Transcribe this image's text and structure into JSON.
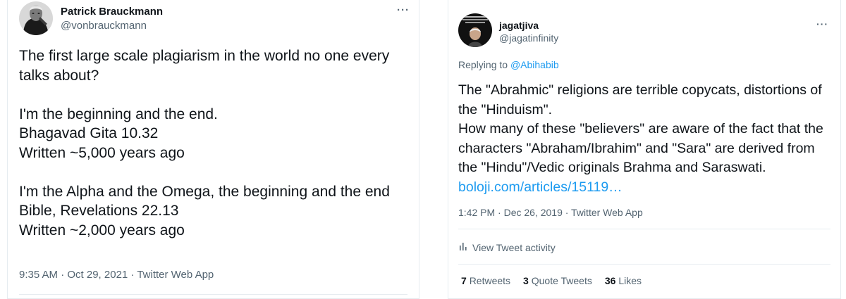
{
  "left_tweet": {
    "name": "Patrick Brauckmann",
    "handle": "@vonbrauckmann",
    "text": "The first large scale plagiarism in the world no one every talks about?\n\nI'm the beginning and the end.\nBhagavad Gita 10.32\nWritten ~5,000 years ago\n\nI'm the Alpha and the Omega, the beginning and the end\nBible, Revelations 22.13\nWritten ~2,000 years ago",
    "meta": "9:35 AM · Oct 29, 2021 · Twitter Web App",
    "more_icon": "more-icon"
  },
  "right_tweet": {
    "name": "jagatjiva",
    "handle": "@jagatinfinity",
    "reply_prefix": "Replying to ",
    "reply_to": "@Abihabib",
    "text": "The \"Abrahmic\" religions are terrible copycats, distortions of the \"Hinduism\".\nHow many of these  \"believers\" are aware of the fact that the characters \"Abraham/Ibrahim\"  and \"Sara\" are derived from the \"Hindu\"/Vedic originals Brahma and Saraswati. ",
    "link": "boloji.com/articles/15119…",
    "meta": "1:42 PM · Dec 26, 2019 · Twitter Web App",
    "activity_label": "View Tweet activity",
    "stats": {
      "retweets_count": "7",
      "retweets_label": "Retweets",
      "quotes_count": "3",
      "quotes_label": "Quote Tweets",
      "likes_count": "36",
      "likes_label": "Likes"
    }
  },
  "colors": {
    "link": "#1d9bf0",
    "secondary_text": "#536471",
    "divider": "#e6ecf0"
  }
}
